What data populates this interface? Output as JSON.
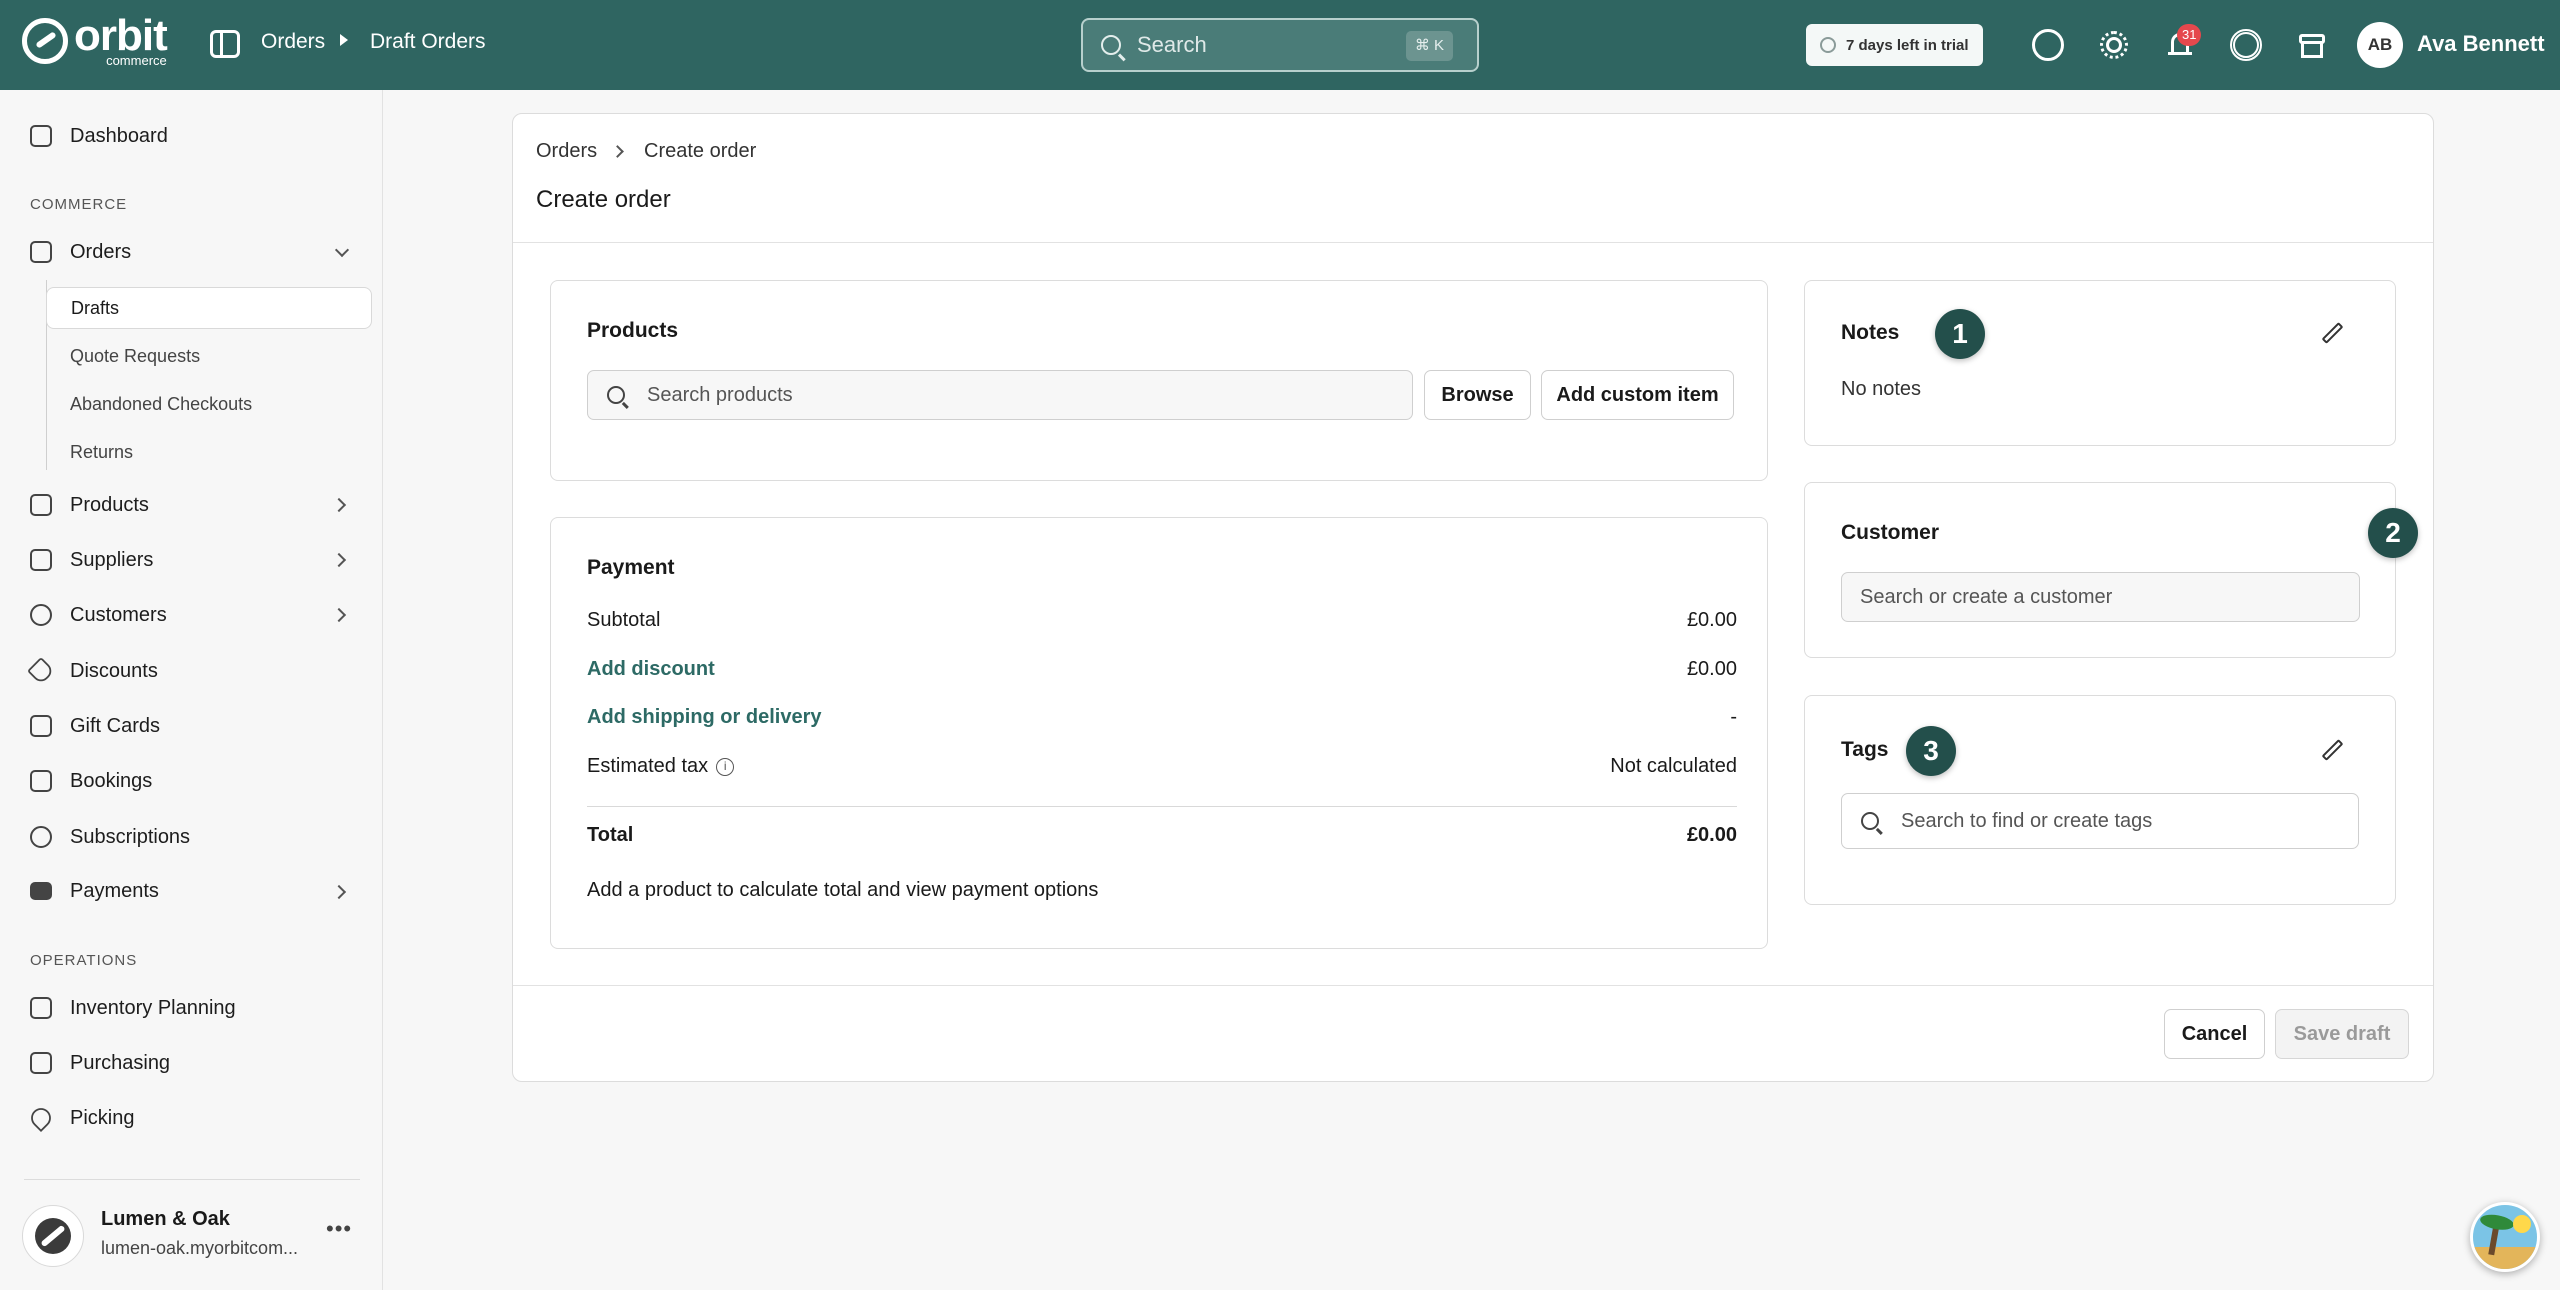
{
  "topbar": {
    "logo_text": "orbit",
    "logo_sub": "commerce",
    "breadcrumb": [
      "Orders",
      "Draft Orders"
    ],
    "search_placeholder": "Search",
    "search_shortcut": "⌘ K",
    "trial_label": "7 days left in trial",
    "notification_count": "31",
    "user_initials": "AB",
    "user_name": "Ava Bennett",
    "accent_color": "#2f6561"
  },
  "sidebar": {
    "dashboard": "Dashboard",
    "commerce_label": "COMMERCE",
    "orders": "Orders",
    "order_sub": [
      "Drafts",
      "Quote Requests",
      "Abandoned Checkouts",
      "Returns"
    ],
    "items": [
      "Products",
      "Suppliers",
      "Customers",
      "Discounts",
      "Gift Cards",
      "Bookings",
      "Subscriptions",
      "Payments"
    ],
    "operations_label": "OPERATIONS",
    "operations": [
      "Inventory Planning",
      "Purchasing",
      "Picking"
    ],
    "store_name": "Lumen & Oak",
    "store_url": "lumen-oak.myorbitcom..."
  },
  "page": {
    "breadcrumb": [
      "Orders",
      "Create order"
    ],
    "title": "Create order"
  },
  "products": {
    "title": "Products",
    "search_placeholder": "Search products",
    "browse": "Browse",
    "add_custom": "Add custom item"
  },
  "payment": {
    "title": "Payment",
    "subtotal_label": "Subtotal",
    "subtotal_value": "£0.00",
    "discount_label": "Add discount",
    "discount_value": "£0.00",
    "shipping_label": "Add shipping or delivery",
    "shipping_value": "-",
    "tax_label": "Estimated tax",
    "tax_value": "Not calculated",
    "total_label": "Total",
    "total_value": "£0.00",
    "hint": "Add a product to calculate total and view payment options"
  },
  "notes": {
    "title": "Notes",
    "step": "1",
    "value": "No notes"
  },
  "customer": {
    "title": "Customer",
    "step": "2",
    "placeholder": "Search or create a customer"
  },
  "tags": {
    "title": "Tags",
    "step": "3",
    "placeholder": "Search to find or create tags"
  },
  "footer": {
    "cancel": "Cancel",
    "save": "Save draft"
  }
}
